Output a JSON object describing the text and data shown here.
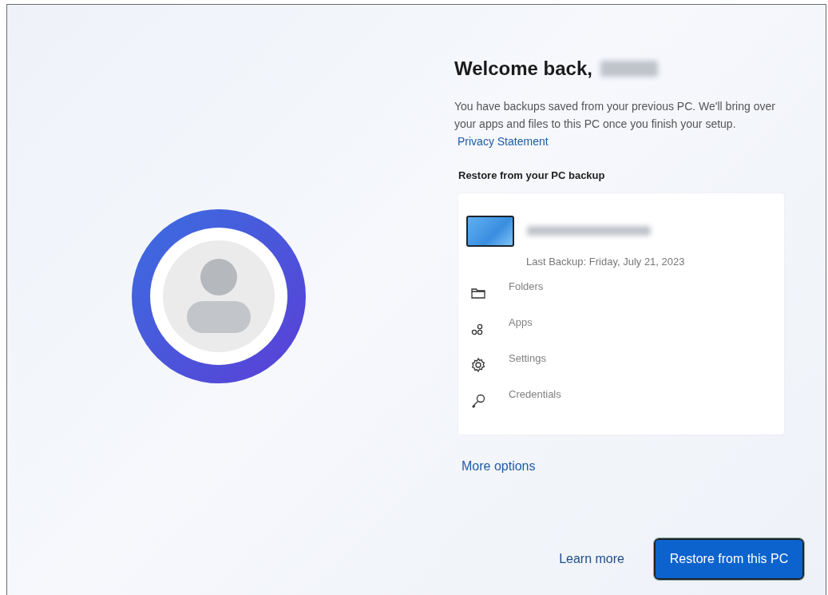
{
  "title": "Welcome back,",
  "description": "You have backups saved from your previous PC. We'll bring over your apps and files to this PC once you finish your setup.",
  "privacy_link": "Privacy Statement",
  "section_heading": "Restore from your PC backup",
  "backup": {
    "last_backup": "Last Backup: Friday, July 21, 2023",
    "items": [
      {
        "kind": "folders",
        "label": "Folders"
      },
      {
        "kind": "apps",
        "label": "Apps"
      },
      {
        "kind": "settings",
        "label": "Settings"
      },
      {
        "kind": "credentials",
        "label": "Credentials"
      }
    ]
  },
  "more_options": "More options",
  "buttons": [
    {
      "kind": "link",
      "label": "Learn more"
    },
    {
      "kind": "primary",
      "label": "Restore from this PC"
    }
  ]
}
